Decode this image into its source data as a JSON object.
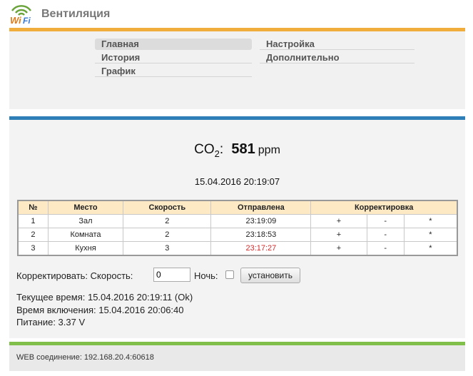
{
  "header": {
    "logo_text": "WiFi",
    "title": "Вентиляция"
  },
  "nav": {
    "left": [
      "Главная",
      "История",
      "График"
    ],
    "right": [
      "Настройка",
      "Дополнительно"
    ]
  },
  "reading": {
    "label": "CO",
    "label_sub": "2",
    "colon": ":",
    "value": "581",
    "unit": "ppm",
    "datetime": "15.04.2016 20:19:07"
  },
  "table": {
    "headers": [
      "№",
      "Место",
      "Скорость",
      "Отправлена",
      "Корректировка"
    ],
    "rows": [
      {
        "num": "1",
        "place": "Зал",
        "speed": "2",
        "sent": "23:19:09",
        "plus": "+",
        "minus": "-",
        "star": "*"
      },
      {
        "num": "2",
        "place": "Комната",
        "speed": "2",
        "sent": "23:18:53",
        "plus": "+",
        "minus": "-",
        "star": "*"
      },
      {
        "num": "3",
        "place": "Кухня",
        "speed": "3",
        "sent": "23:17:27",
        "plus": "+",
        "minus": "-",
        "star": "*"
      }
    ]
  },
  "controls": {
    "correct_label": "Корректировать: Скорость:",
    "speed_value": "0",
    "night_label": "Ночь:",
    "night_checked": false,
    "set_button": "установить"
  },
  "status": {
    "current_time": "Текущее время: 15.04.2016 20:19:11 (Ok)",
    "start_time": "Время включения: 15.04.2016 20:06:40",
    "power": "Питание: 3.37 V"
  },
  "footer": {
    "connection": "WEB соединение: 192.168.20.4:60618"
  },
  "colors": {
    "nav_accent": "#f0ad3c",
    "main_accent": "#2e7fb7",
    "footer_accent": "#7fbf4a",
    "late": "#d62a2a",
    "table_header_bg": "#fde9c4"
  }
}
